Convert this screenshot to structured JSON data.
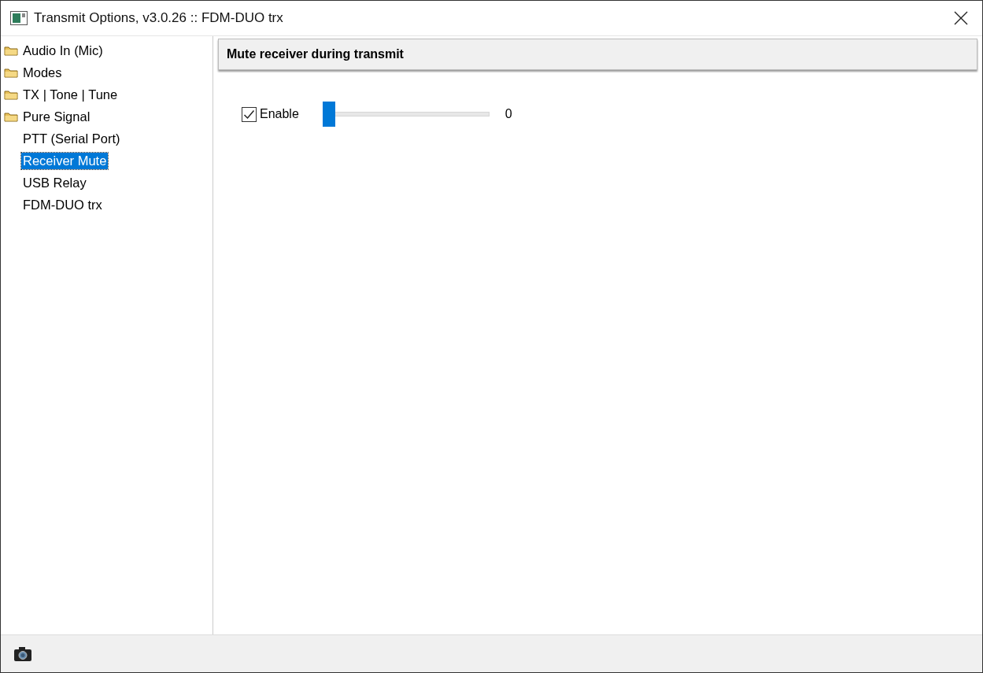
{
  "window": {
    "title": "Transmit Options, v3.0.26 :: FDM-DUO trx"
  },
  "sidebar": {
    "items": [
      {
        "label": "Audio In (Mic)",
        "kind": "folder",
        "selected": false
      },
      {
        "label": "Modes",
        "kind": "folder",
        "selected": false
      },
      {
        "label": "TX | Tone | Tune",
        "kind": "folder",
        "selected": false
      },
      {
        "label": "Pure Signal",
        "kind": "folder",
        "selected": false
      },
      {
        "label": "PTT (Serial Port)",
        "kind": "page",
        "selected": false
      },
      {
        "label": "Receiver Mute",
        "kind": "page",
        "selected": true
      },
      {
        "label": "USB Relay",
        "kind": "page",
        "selected": false
      },
      {
        "label": "FDM-DUO trx",
        "kind": "page",
        "selected": false
      }
    ]
  },
  "panel": {
    "header": "Mute receiver during transmit",
    "enable": {
      "label": "Enable",
      "checked": true
    },
    "slider": {
      "level": 0,
      "reading": "0"
    }
  }
}
